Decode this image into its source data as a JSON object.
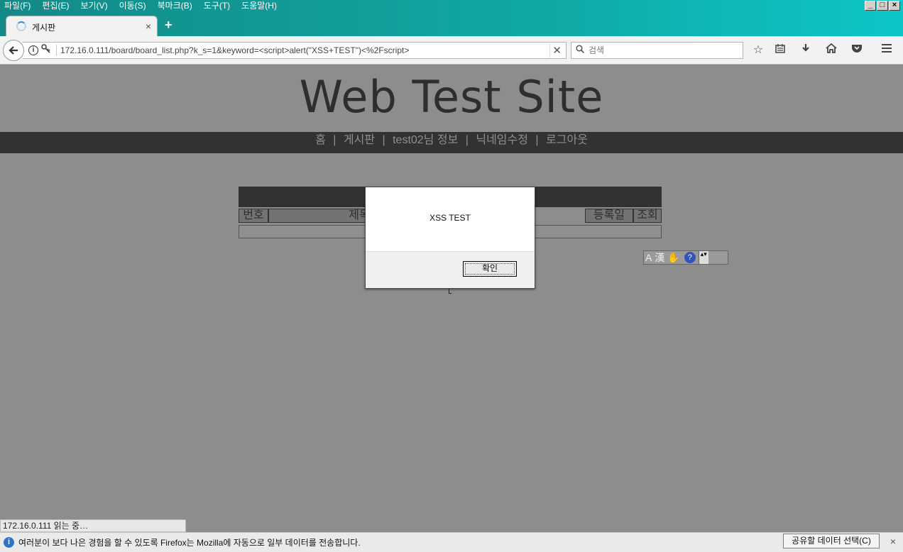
{
  "menubar": {
    "items": [
      "파일(F)",
      "편집(E)",
      "보기(V)",
      "이동(S)",
      "북마크(B)",
      "도구(T)",
      "도움말(H)"
    ]
  },
  "window_controls": {
    "minimize": "_",
    "maximize": "□",
    "close": "×"
  },
  "tab": {
    "title": "게시판",
    "close": "×",
    "new_tab": "+"
  },
  "navbar": {
    "url": "172.16.0.111/board/board_list.php?k_s=1&keyword=<script>alert(\"XSS+TEST\")<%2Fscript>",
    "search_placeholder": "검색",
    "info_icon": "i"
  },
  "site": {
    "title": "Web Test Site",
    "nav": [
      "홈",
      "게시판",
      "test02님 정보",
      "닉네임수정",
      "로그아웃"
    ],
    "nav_separator": "|"
  },
  "board": {
    "columns": [
      "번호",
      "제목",
      "",
      "등록일",
      "조회"
    ]
  },
  "ime": {
    "a": "A",
    "han": "漢",
    "help": "?",
    "arrows": "▴▾"
  },
  "dialog": {
    "message": "XSS TEST",
    "ok_label": "확인"
  },
  "statusbar": {
    "text": "172.16.0.111 읽는 중…"
  },
  "notification": {
    "text": "여러분이 보다 나은 경험을 할 수 있도록 Firefox는 Mozilla에 자동으로 일부 데이터를 전송합니다.",
    "button": "공유할 데이터 선택(C)",
    "close": "×"
  }
}
